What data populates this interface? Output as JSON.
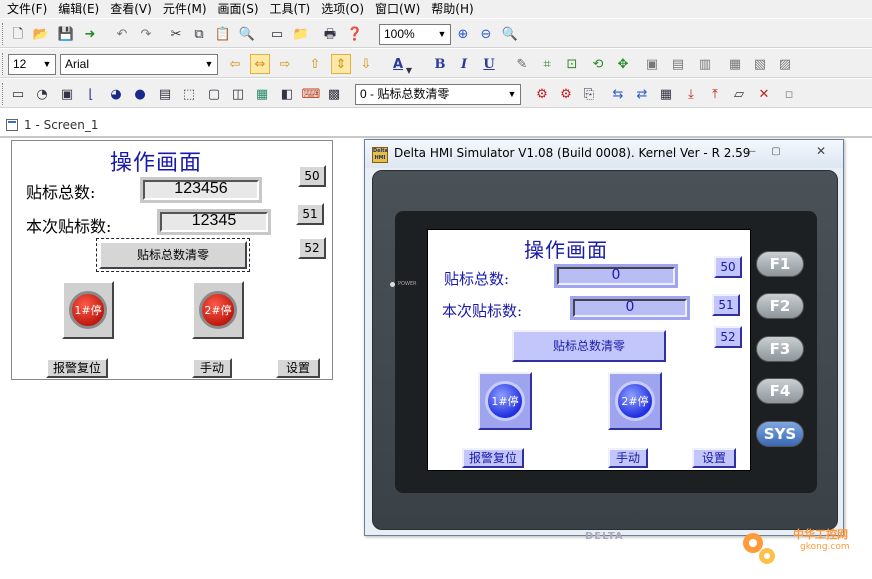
{
  "menu": [
    "文件(F)",
    "编辑(E)",
    "查看(V)",
    "元件(M)",
    "画面(S)",
    "工具(T)",
    "选项(O)",
    "窗口(W)",
    "帮助(H)"
  ],
  "toolbar": {
    "zoom": "100%",
    "font_size": "12",
    "font_name": "Arial",
    "bold": "B",
    "italic": "I",
    "underline": "U",
    "text_color": "A",
    "screen_select": "0 - 贴标总数清零"
  },
  "mdi_tab": {
    "label": "1 - Screen_1"
  },
  "editor": {
    "title": "操作画面",
    "total_label": "贴标总数:",
    "total_value": "123456",
    "current_label": "本次贴标数:",
    "current_value": "12345",
    "clear_button": "贴标总数清零",
    "btn_50": "50",
    "btn_51": "51",
    "btn_52": "52",
    "stop1": "1#停",
    "stop2": "2#停",
    "alarm_reset": "报警复位",
    "manual": "手动",
    "settings": "设置"
  },
  "simulator": {
    "title": "Delta HMI Simulator V1.08 (Build 0008). Kernel Ver - R 2.59",
    "logo_text": "Delta HMI",
    "power_label": "POWER",
    "brand": "DELTA",
    "fkeys": [
      "F1",
      "F2",
      "F3",
      "F4",
      "SYS"
    ],
    "screen": {
      "title": "操作画面",
      "total_label": "贴标总数:",
      "total_value": "0",
      "current_label": "本次贴标数:",
      "current_value": "0",
      "clear_button": "贴标总数清零",
      "btn_50": "50",
      "btn_51": "51",
      "btn_52": "52",
      "stop1": "1#停",
      "stop2": "2#停",
      "alarm_reset": "报警复位",
      "manual": "手动",
      "settings": "设置"
    }
  },
  "watermark": {
    "name": "中华工控网",
    "url": "gkong.com"
  },
  "colors": {
    "hmi_text": "#1a1aa8",
    "hmi_widget": "#9ea4ee",
    "stop_red": "#c01a10",
    "stop_blue": "#2030e0"
  }
}
